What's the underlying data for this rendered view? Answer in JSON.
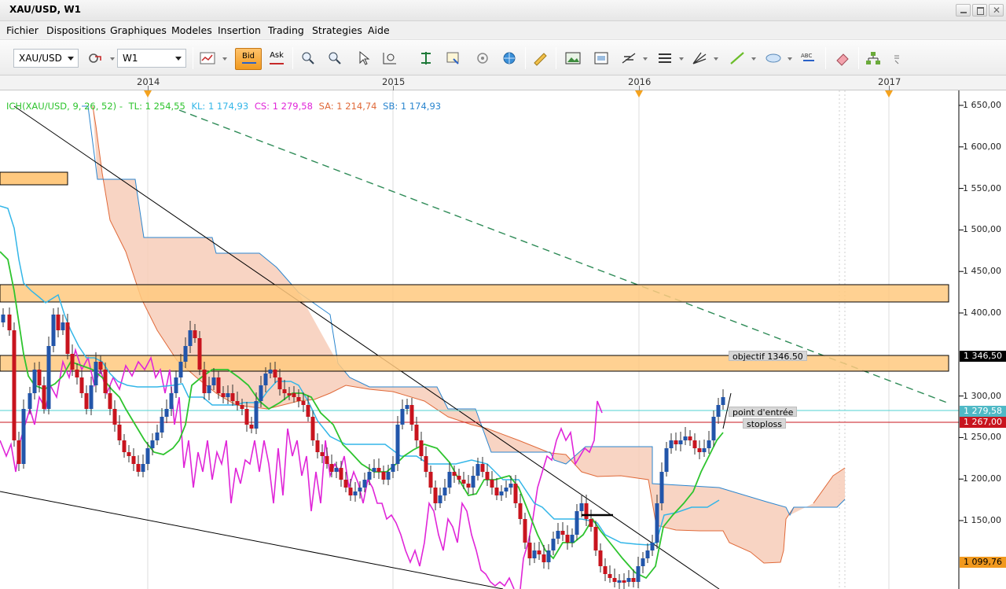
{
  "window": {
    "title": "XAU/USD, W1"
  },
  "menu": [
    "Fichier",
    "Dispositions",
    "Graphiques",
    "Modeles",
    "Insertion",
    "Trading",
    "Strategies",
    "Aide"
  ],
  "toolbar": {
    "symbol": "XAU/USD",
    "timeframe": "W1",
    "bid_label": "Bid",
    "ask_label": "Ask",
    "icons": [
      "chart-style-icon",
      "indicator-icon",
      "crosshair-icon",
      "zoom-icon",
      "period-icon",
      "object-list-icon",
      "news-icon",
      "screenshot-icon",
      "globe-icon",
      "ruler-icon",
      "picture-icon",
      "save-image-icon",
      "fibonacci-icon",
      "channel-icon",
      "gann-icon",
      "trendline-icon",
      "ellipse-icon",
      "text-icon",
      "eraser-icon",
      "hierarchy-icon"
    ]
  },
  "chart": {
    "instrument": "XAU/USD",
    "timeframe": "W1",
    "legend": {
      "ichimoku": "ICH(XAU/USD, 9, 26, 52) -",
      "tl": "TL: 1 254,55",
      "kl": "KL: 1 174,93",
      "cs": "CS: 1 279,58",
      "sa": "SA: 1 214,74",
      "sb": "SB: 1 174,93"
    },
    "colors": {
      "tenkan": "#2ec42e",
      "kijun": "#33b6e8",
      "chikou": "#e025d8",
      "senkou_a": "#e06a3a",
      "senkou_b": "#2b86cf",
      "kumo_fill": "#f7cdb8",
      "zone_fill": "#ffc97f",
      "trend_dashed": "#2e8b57",
      "candle_up": "#2255aa",
      "candle_down": "#c8141e",
      "entry_line": "#4fd2d2",
      "stop_line": "#c8141e",
      "current_price": "#c8141e"
    },
    "x_axis": {
      "years": [
        "2014",
        "2015",
        "2016",
        "2017"
      ]
    },
    "y_axis": {
      "ticks": [
        "1 650,00",
        "1 600,00",
        "1 550,00",
        "1 500,00",
        "1 450,00",
        "1 400,00",
        "1 300,00",
        "1 250,00",
        "1 200,00",
        "1 150,00"
      ],
      "range": [
        1085,
        1660
      ]
    },
    "price_labels": {
      "objective": "1 346,50",
      "entry": "1 279,58",
      "stoploss": "1 267,00",
      "low": "1 099,76"
    },
    "annotations": {
      "objective": "objectif 1346.50",
      "entry": "point d'entrée",
      "stoploss": "stoploss"
    }
  }
}
